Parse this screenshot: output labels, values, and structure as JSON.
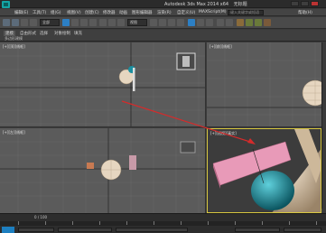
{
  "title_bar": {
    "app_title": "Autodesk 3ds Max 2014 x64",
    "doc_title": "无标题"
  },
  "menu": {
    "items": [
      "编辑(E)",
      "工具(T)",
      "组(G)",
      "视图(V)",
      "创建(C)",
      "修改器",
      "动画",
      "图形编辑器",
      "渲染(R)",
      "自定义(U)",
      "MAXScript(M)",
      "帮助(H)"
    ],
    "search_placeholder": "键入关键字或短语"
  },
  "toolbar": {
    "workspace_select": "全部",
    "view_select": "视图"
  },
  "ribbon": {
    "tabs": [
      "建模",
      "自由形式",
      "选择",
      "对象绘制",
      "填充"
    ],
    "sub_label": "多边形建模"
  },
  "viewports": {
    "top_left_label": "[+][顶][线框]",
    "top_right_label": "[+][前][线框]",
    "bottom_left_label": "[+][左][线框]",
    "bottom_right_label": "[+][透视][真实]"
  },
  "timeline": {
    "frame_counter": "0 / 100"
  },
  "colors": {
    "accent": "#1d7fc0",
    "arrow": "#d42b2b",
    "box_pink": "#e89ab8",
    "teapot_teal": "#1b8fa0",
    "sphere_beige": "#d8c4a8"
  }
}
